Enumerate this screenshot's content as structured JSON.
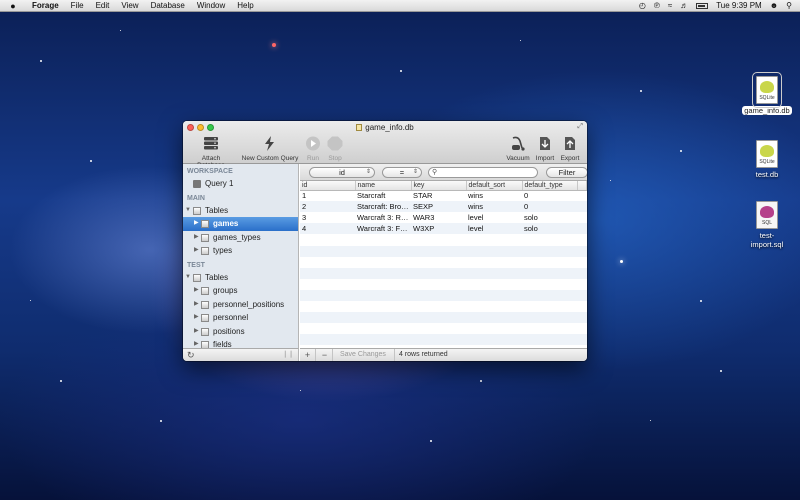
{
  "menubar": {
    "apple": "",
    "app_name": "Forage",
    "menus": [
      "File",
      "Edit",
      "View",
      "Database",
      "Window",
      "Help"
    ],
    "clock": "Tue 9:39 PM"
  },
  "window": {
    "title": "game_info.db",
    "toolbar": {
      "attach": "Attach Database",
      "custom_query": "New Custom Query",
      "run": "Run",
      "stop": "Stop",
      "vacuum": "Vacuum",
      "import": "Import",
      "export": "Export"
    },
    "sidebar": {
      "workspace_header": "WORKSPACE",
      "query": "Query 1",
      "main_header": "MAIN",
      "main_tables": "Tables",
      "main_items": [
        "games",
        "games_types",
        "types"
      ],
      "test_header": "TEST",
      "test_tables": "Tables",
      "test_items": [
        "groups",
        "personnel_positions",
        "personnel",
        "positions",
        "fields"
      ]
    },
    "filter": {
      "column": "id",
      "operator": "=",
      "search_value": "",
      "filter_button": "Filter"
    },
    "table": {
      "columns": [
        "id",
        "name",
        "key",
        "default_sort",
        "default_type"
      ],
      "rows": [
        [
          "1",
          "Starcraft",
          "STAR",
          "wins",
          "0"
        ],
        [
          "2",
          "Starcraft: Bro…",
          "SEXP",
          "wins",
          "0"
        ],
        [
          "3",
          "Warcraft 3: R…",
          "WAR3",
          "level",
          "solo"
        ],
        [
          "4",
          "Warcraft 3: F…",
          "W3XP",
          "level",
          "solo"
        ]
      ]
    },
    "bottom": {
      "add": "+",
      "remove": "−",
      "save_changes": "Save Changes",
      "status": "4 rows returned"
    }
  },
  "desktop_icons": [
    {
      "name": "game_info.db",
      "tag": "SQLite",
      "selected": true
    },
    {
      "name": "test.db",
      "tag": "SQLite",
      "selected": false
    },
    {
      "name": "test-\nimport.sql",
      "tag": "SQL",
      "selected": false
    }
  ]
}
